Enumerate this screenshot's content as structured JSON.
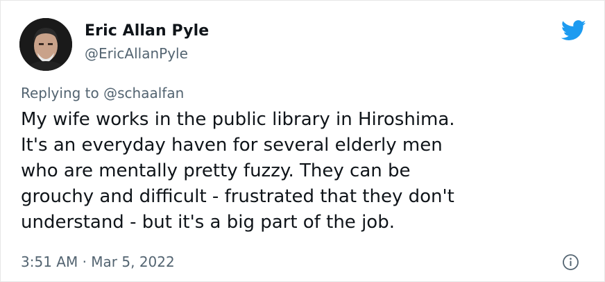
{
  "tweet": {
    "author_name": "Eric Allan Pyle",
    "author_handle": "@EricAllanPyle",
    "reply_prefix": "Replying to",
    "reply_handle": "@schaalfan",
    "text_lines": [
      "My wife works in the public library in Hiroshima.",
      "It's an everyday haven for several elderly men",
      "who are mentally pretty fuzzy. They can be",
      "grouchy and difficult - frustrated that they don't",
      "understand - but it's a big part of the job."
    ],
    "time": "3:51 AM",
    "separator": "·",
    "date": "Mar 5, 2022"
  },
  "icons": {
    "brand_logo": "twitter-bird-icon",
    "info": "info-icon"
  },
  "colors": {
    "twitter_blue": "#1d9bf0",
    "text_primary": "#0f1419",
    "text_secondary": "#536471"
  }
}
